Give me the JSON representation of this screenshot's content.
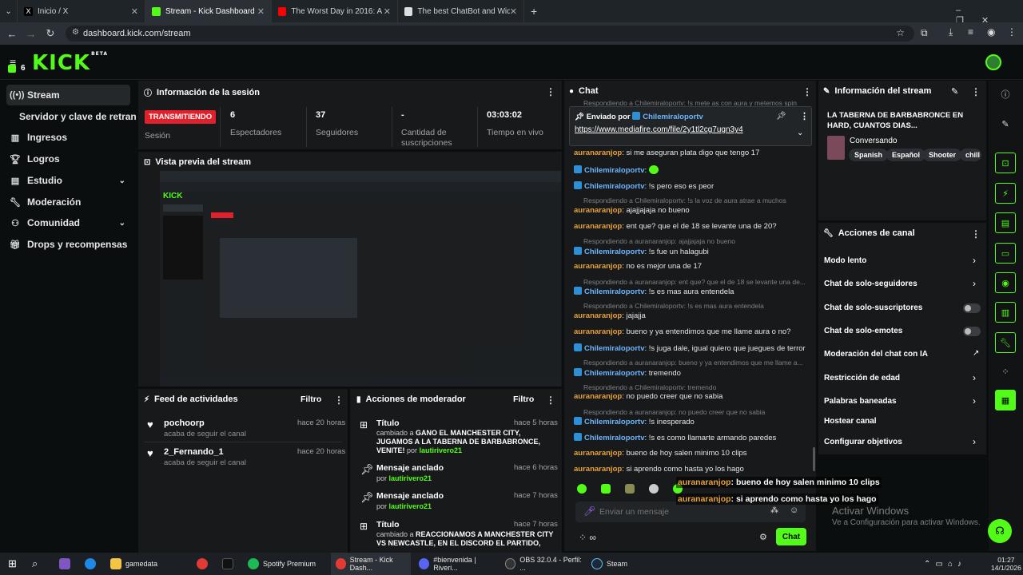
{
  "browser": {
    "tabs": [
      {
        "label": "Inicio / X",
        "icon": "x-icon"
      },
      {
        "label": "Stream - Kick Dashboard",
        "icon": "kick-icon"
      },
      {
        "label": "The Worst Day in 2016: A Playli",
        "icon": "youtube-icon"
      },
      {
        "label": "The best ChatBot and Widgets",
        "icon": "botrix-icon"
      }
    ],
    "url": "dashboard.kick.com/stream"
  },
  "header": {
    "logo": "KICK",
    "logo_sup": "BETA",
    "counter": "6"
  },
  "sidebar": {
    "items": [
      {
        "label": "Stream"
      },
      {
        "label": "Servidor y clave de retransm"
      },
      {
        "label": "Ingresos"
      },
      {
        "label": "Logros"
      },
      {
        "label": "Estudio"
      },
      {
        "label": "Moderación"
      },
      {
        "label": "Comunidad"
      },
      {
        "label": "Drops y recompensas"
      }
    ]
  },
  "session": {
    "title": "Información de la sesión",
    "status": "TRANSMITIENDO",
    "status_label": "Sesión",
    "stats": [
      {
        "value": "6",
        "label": "Espectadores"
      },
      {
        "value": "37",
        "label": "Seguidores"
      },
      {
        "value": "-",
        "label": "Cantidad de suscripciones"
      },
      {
        "value": "03:03:02",
        "label": "Tiempo en vivo"
      }
    ]
  },
  "preview": {
    "title": "Vista previa del stream"
  },
  "feed": {
    "title": "Feed de actividades",
    "filter": "Filtro",
    "items": [
      {
        "name": "pochoorp",
        "sub": "acaba de seguir el canal",
        "time": "hace 20 horas"
      },
      {
        "name": "2_Fernando_1",
        "sub": "acaba de seguir el canal",
        "time": "hace 20 horas"
      }
    ]
  },
  "mod": {
    "title": "Acciones de moderador",
    "filter": "Filtro",
    "items": [
      {
        "title": "Título",
        "time": "hace 5 horas",
        "pre": "cambiado a ",
        "bold": "GANO EL MANCHESTER CITY, JUGAMOS A LA TABERNA DE BARBABRONCE, VENITE!",
        "by": " por ",
        "user": "lautirivero21"
      },
      {
        "title": "Mensaje anclado",
        "time": "hace 6 horas",
        "pre": "",
        "bold": "",
        "by": "por ",
        "user": "lautirivero21"
      },
      {
        "title": "Mensaje anclado",
        "time": "hace 7 horas",
        "pre": "",
        "bold": "",
        "by": "por ",
        "user": "lautirivero21"
      },
      {
        "title": "Título",
        "time": "hace 7 horas",
        "pre": "cambiado a ",
        "bold": "REACCIONAMOS A MANCHESTER CITY VS NEWCASTLE, EN EL DISCORD EL PARTIDO,",
        "by": "",
        "user": ""
      }
    ]
  },
  "chat": {
    "title": "Chat",
    "top_reply": "Respondiendo a Chilemiraloportv: !s mete as con aura y metemos spin",
    "pinned_by_label": "Enviado por",
    "pinned_by": "Chilemiraloportv",
    "pinned_link": "https://www.mediafire.com/file/2y1tl2cg7ugn3y4",
    "messages": [
      {
        "reply": "",
        "user": "auranaranjop",
        "color": "or",
        "text": "si me aseguran plata digo que tengo 17"
      },
      {
        "reply": "",
        "user": "Chilemiraloportv",
        "color": "bl",
        "text": ""
      },
      {
        "reply": "",
        "user": "Chilemiraloportv",
        "color": "bl",
        "text": "!s pero eso es peor"
      },
      {
        "reply": "Respondiendo a Chilemiraloportv: !s la voz de aura atrae a muchos",
        "user": "auranaranjop",
        "color": "or",
        "text": "ajajjajaja no bueno"
      },
      {
        "reply": "",
        "user": "auranaranjop",
        "color": "or",
        "text": "ent que? que el de 18 se levante una de 20?"
      },
      {
        "reply": "Respondiendo a auranaranjop: ajajjajaja no bueno",
        "user": "Chilemiraloportv",
        "color": "bl",
        "text": "!s fue un halagubi"
      },
      {
        "reply": "",
        "user": "auranaranjop",
        "color": "or",
        "text": "no es mejor una de 17"
      },
      {
        "reply": "Respondiendo a auranaranjop: ent que? que el de 18 se levante una de...",
        "user": "Chilemiraloportv",
        "color": "bl",
        "text": "!s es mas aura entendela"
      },
      {
        "reply": "Respondiendo a Chilemiraloportv: !s es mas aura entendela",
        "user": "auranaranjop",
        "color": "or",
        "text": "jajajja"
      },
      {
        "reply": "",
        "user": "auranaranjop",
        "color": "or",
        "text": "bueno y ya entendimos que me llame aura o no?"
      },
      {
        "reply": "",
        "user": "Chilemiraloportv",
        "color": "bl",
        "text": "!s juga dale, igual quiero que juegues de terror"
      },
      {
        "reply": "Respondiendo a auranaranjop: bueno y ya entendimos que me llame a...",
        "user": "Chilemiraloportv",
        "color": "bl",
        "text": "tremendo"
      },
      {
        "reply": "Respondiendo a Chilemiraloportv: tremendo",
        "user": "auranaranjop",
        "color": "or",
        "text": "no puedo creer que no sabia"
      },
      {
        "reply": "Respondiendo a auranaranjop: no puedo creer que no sabia",
        "user": "Chilemiraloportv",
        "color": "bl",
        "text": "!s inesperado"
      },
      {
        "reply": "",
        "user": "Chilemiraloportv",
        "color": "bl",
        "text": "!s es como llamarte armando paredes"
      },
      {
        "reply": "",
        "user": "auranaranjop",
        "color": "or",
        "text": "bueno de hoy salen minimo 10 clips"
      },
      {
        "reply": "",
        "user": "auranaranjop",
        "color": "or",
        "text": "si aprendo como hasta yo los hago"
      }
    ],
    "input_placeholder": "Enviar un mensaje",
    "send_label": "Chat",
    "overlay": [
      {
        "user": "auranaranjop",
        "text": ": bueno de hoy salen minimo 10 clips"
      },
      {
        "user": "auranaranjop",
        "text": ": si aprendo como hasta yo los hago"
      }
    ]
  },
  "stream_info": {
    "title": "Información del stream",
    "stream_title": "LA TABERNA DE BARBABRONCE EN HARD, CUANTOS DIAS...",
    "category": "Conversando",
    "tags": [
      "Spanish",
      "Español",
      "Shooter",
      "chill"
    ]
  },
  "channel_actions": {
    "title": "Acciones de canal",
    "items": [
      {
        "label": "Modo lento",
        "kind": "chevron"
      },
      {
        "label": "Chat de solo-seguidores",
        "kind": "chevron"
      },
      {
        "label": "Chat de solo-suscriptores",
        "kind": "toggle"
      },
      {
        "label": "Chat de solo-emotes",
        "kind": "toggle"
      },
      {
        "label": "Moderación del chat con IA",
        "kind": "external"
      },
      {
        "label": "Restricción de edad",
        "kind": "chevron"
      },
      {
        "label": "Palabras baneadas",
        "kind": "chevron"
      },
      {
        "label": "Hostear canal",
        "kind": "none"
      },
      {
        "label": "Configurar objetivos",
        "kind": "chevron"
      }
    ]
  },
  "windows_watermark": {
    "line1": "Activar Windows",
    "line2": "Ve a Configuración para activar Windows."
  },
  "taskbar": {
    "items": [
      "gamedata",
      "Spotify Premium",
      "Stream - Kick Dash...",
      "#bienvenida | Riveri...",
      "OBS 32.0.4 - Perfil: ...",
      "Steam"
    ],
    "time": "01:27",
    "date": "14/1/2026"
  },
  "colors": {
    "accent": "#53fc18",
    "live": "#e0202a",
    "panel": "#18191b",
    "bg": "#0b0e0f"
  }
}
